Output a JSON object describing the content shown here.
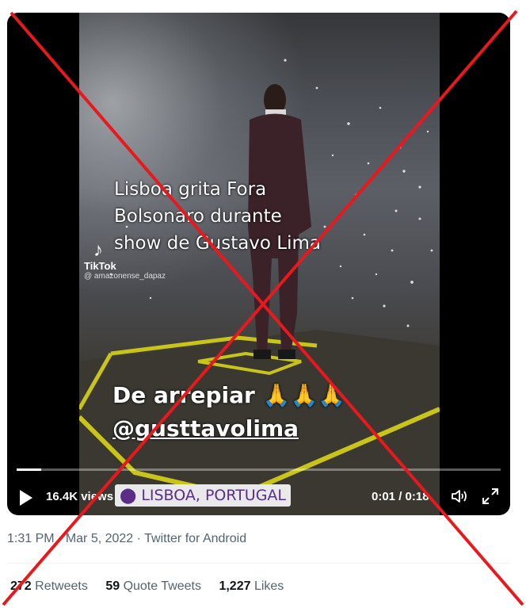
{
  "video": {
    "overlay_caption_lines": [
      "Lisboa grita Fora",
      "Bolsonaro durante",
      "show de Gustavo Lima"
    ],
    "overlay_reaction_lines": [
      "De arrepiar 🙏🙏🙏",
      "@gusttavolima"
    ],
    "tiktok_brand": "TikTok",
    "tiktok_user": "@ amazonense_dapaz",
    "location_tag": "LISBOA, PORTUGAL",
    "views": "16.4K views",
    "time_display": "0:01 / 0:18",
    "progress_fraction": 0.05
  },
  "meta": {
    "time": "1:31 PM",
    "separator": " · ",
    "date": "Mar 5, 2022",
    "source": "Twitter for Android"
  },
  "stats": {
    "retweets_count": "272",
    "retweets_label": "Retweets",
    "quotes_count": "59",
    "quotes_label": "Quote Tweets",
    "likes_count": "1,227",
    "likes_label": "Likes"
  },
  "colors": {
    "cross": "#e8191d",
    "text_secondary": "#536471",
    "text_primary": "#0f1419",
    "location_tag_text": "#5b2d86"
  }
}
